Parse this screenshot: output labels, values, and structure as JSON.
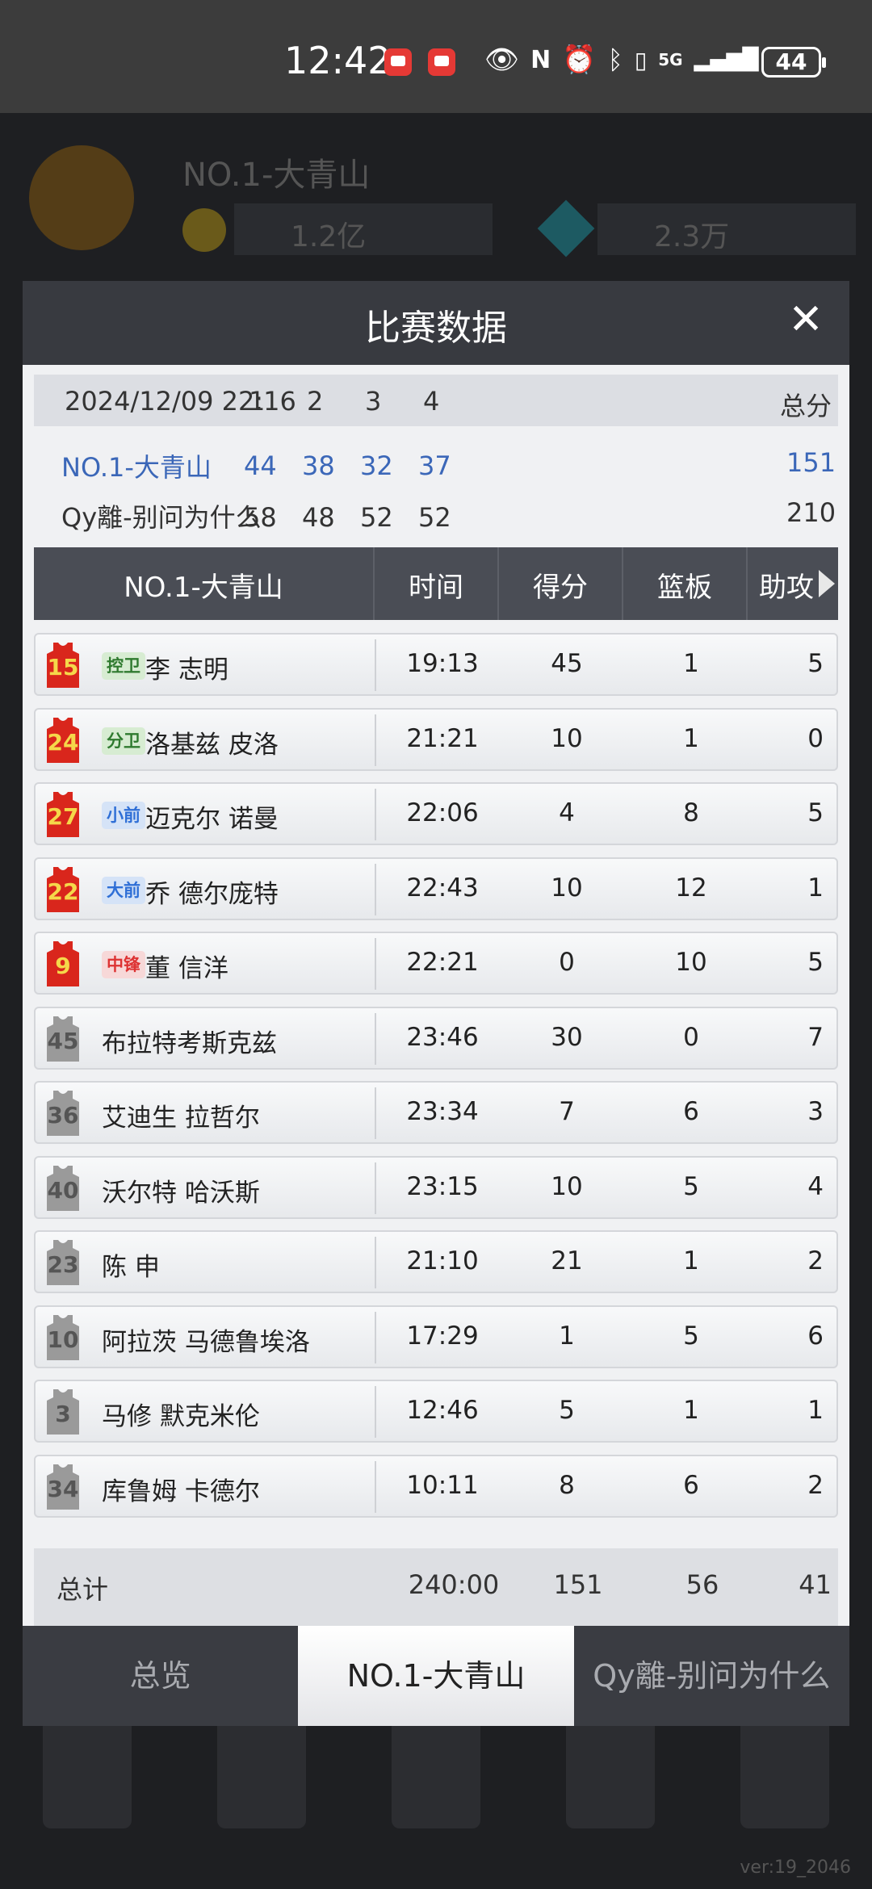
{
  "status_bar": {
    "time": "12:42",
    "battery": "44",
    "icons": [
      "notification-icon",
      "notification-icon",
      "eye-icon",
      "nfc-icon",
      "alarm-icon",
      "bluetooth-icon",
      "vibrate-icon",
      "5g-icon",
      "signal-icon"
    ]
  },
  "background": {
    "team_name": "NO.1-大青山",
    "resource1": "1.2亿",
    "resource2": "2.3万",
    "version": "ver:19_2046"
  },
  "modal": {
    "title": "比赛数据",
    "score": {
      "datetime": "2024/12/09 22:16",
      "quarters": [
        "1",
        "2",
        "3",
        "4"
      ],
      "total_label": "总分",
      "home": {
        "name": "NO.1-大青山",
        "quarters": [
          "44",
          "38",
          "32",
          "37"
        ],
        "total": "151"
      },
      "away": {
        "name": "Qy離-别问为什么",
        "quarters": [
          "58",
          "48",
          "52",
          "52"
        ],
        "total": "210"
      }
    },
    "table": {
      "team_header": "NO.1-大青山",
      "columns": [
        "时间",
        "得分",
        "篮板",
        "助攻"
      ],
      "players": [
        {
          "num": "15",
          "pos": "控卫",
          "name": "李 志明",
          "time": "19:13",
          "pts": "45",
          "reb": "1",
          "ast": "5",
          "starter": true
        },
        {
          "num": "24",
          "pos": "分卫",
          "name": "洛基兹 皮洛",
          "time": "21:21",
          "pts": "10",
          "reb": "1",
          "ast": "0",
          "starter": true
        },
        {
          "num": "27",
          "pos": "小前",
          "name": "迈克尔 诺曼",
          "time": "22:06",
          "pts": "4",
          "reb": "8",
          "ast": "5",
          "starter": true
        },
        {
          "num": "22",
          "pos": "大前",
          "name": "乔 德尔庞特",
          "time": "22:43",
          "pts": "10",
          "reb": "12",
          "ast": "1",
          "starter": true
        },
        {
          "num": "9",
          "pos": "中锋",
          "name": "董 信洋",
          "time": "22:21",
          "pts": "0",
          "reb": "10",
          "ast": "5",
          "starter": true
        },
        {
          "num": "45",
          "pos": "",
          "name": "布拉特考斯克兹",
          "time": "23:46",
          "pts": "30",
          "reb": "0",
          "ast": "7",
          "starter": false
        },
        {
          "num": "36",
          "pos": "",
          "name": "艾迪生 拉哲尔",
          "time": "23:34",
          "pts": "7",
          "reb": "6",
          "ast": "3",
          "starter": false
        },
        {
          "num": "40",
          "pos": "",
          "name": "沃尔特 哈沃斯",
          "time": "23:15",
          "pts": "10",
          "reb": "5",
          "ast": "4",
          "starter": false
        },
        {
          "num": "23",
          "pos": "",
          "name": "陈 申",
          "time": "21:10",
          "pts": "21",
          "reb": "1",
          "ast": "2",
          "starter": false
        },
        {
          "num": "10",
          "pos": "",
          "name": "阿拉茨 马德鲁埃洛",
          "time": "17:29",
          "pts": "1",
          "reb": "5",
          "ast": "6",
          "starter": false
        },
        {
          "num": "3",
          "pos": "",
          "name": "马修 默克米伦",
          "time": "12:46",
          "pts": "5",
          "reb": "1",
          "ast": "1",
          "starter": false
        },
        {
          "num": "34",
          "pos": "",
          "name": "库鲁姆 卡德尔",
          "time": "10:11",
          "pts": "8",
          "reb": "6",
          "ast": "2",
          "starter": false
        }
      ],
      "totals": {
        "label": "总计",
        "time": "240:00",
        "pts": "151",
        "reb": "56",
        "ast": "41"
      }
    },
    "tabs": [
      {
        "label": "总览",
        "active": false
      },
      {
        "label": "NO.1-大青山",
        "active": true
      },
      {
        "label": "Qy離-别问为什么",
        "active": false
      }
    ]
  },
  "colors": {
    "home_team": "#3b67b8",
    "jersey_red": "#d9261c",
    "jersey_gray": "#9a9a9a",
    "pos_green": "#2f7a2f",
    "pos_blue": "#2f6fd6",
    "pos_red": "#d33"
  }
}
